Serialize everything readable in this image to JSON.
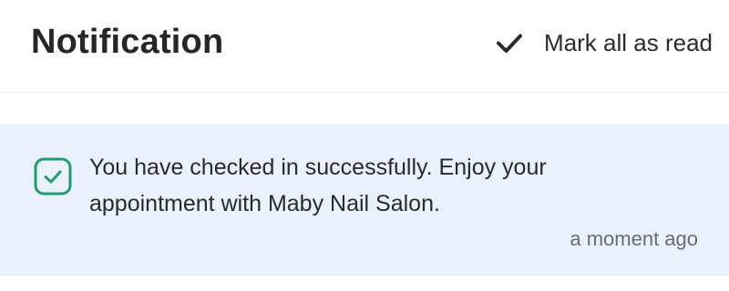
{
  "header": {
    "title": "Notification",
    "mark_all_label": "Mark all as read",
    "mark_all_icon": "checkmark-icon"
  },
  "notifications": [
    {
      "status": "checked-in",
      "icon": "checkbox-checked-icon",
      "icon_color": "#1f9d6b",
      "message": "You have checked in successfully. Enjoy your appointment with Maby Nail Salon.",
      "time": "a moment ago",
      "background": "#eaf1fd"
    }
  ]
}
